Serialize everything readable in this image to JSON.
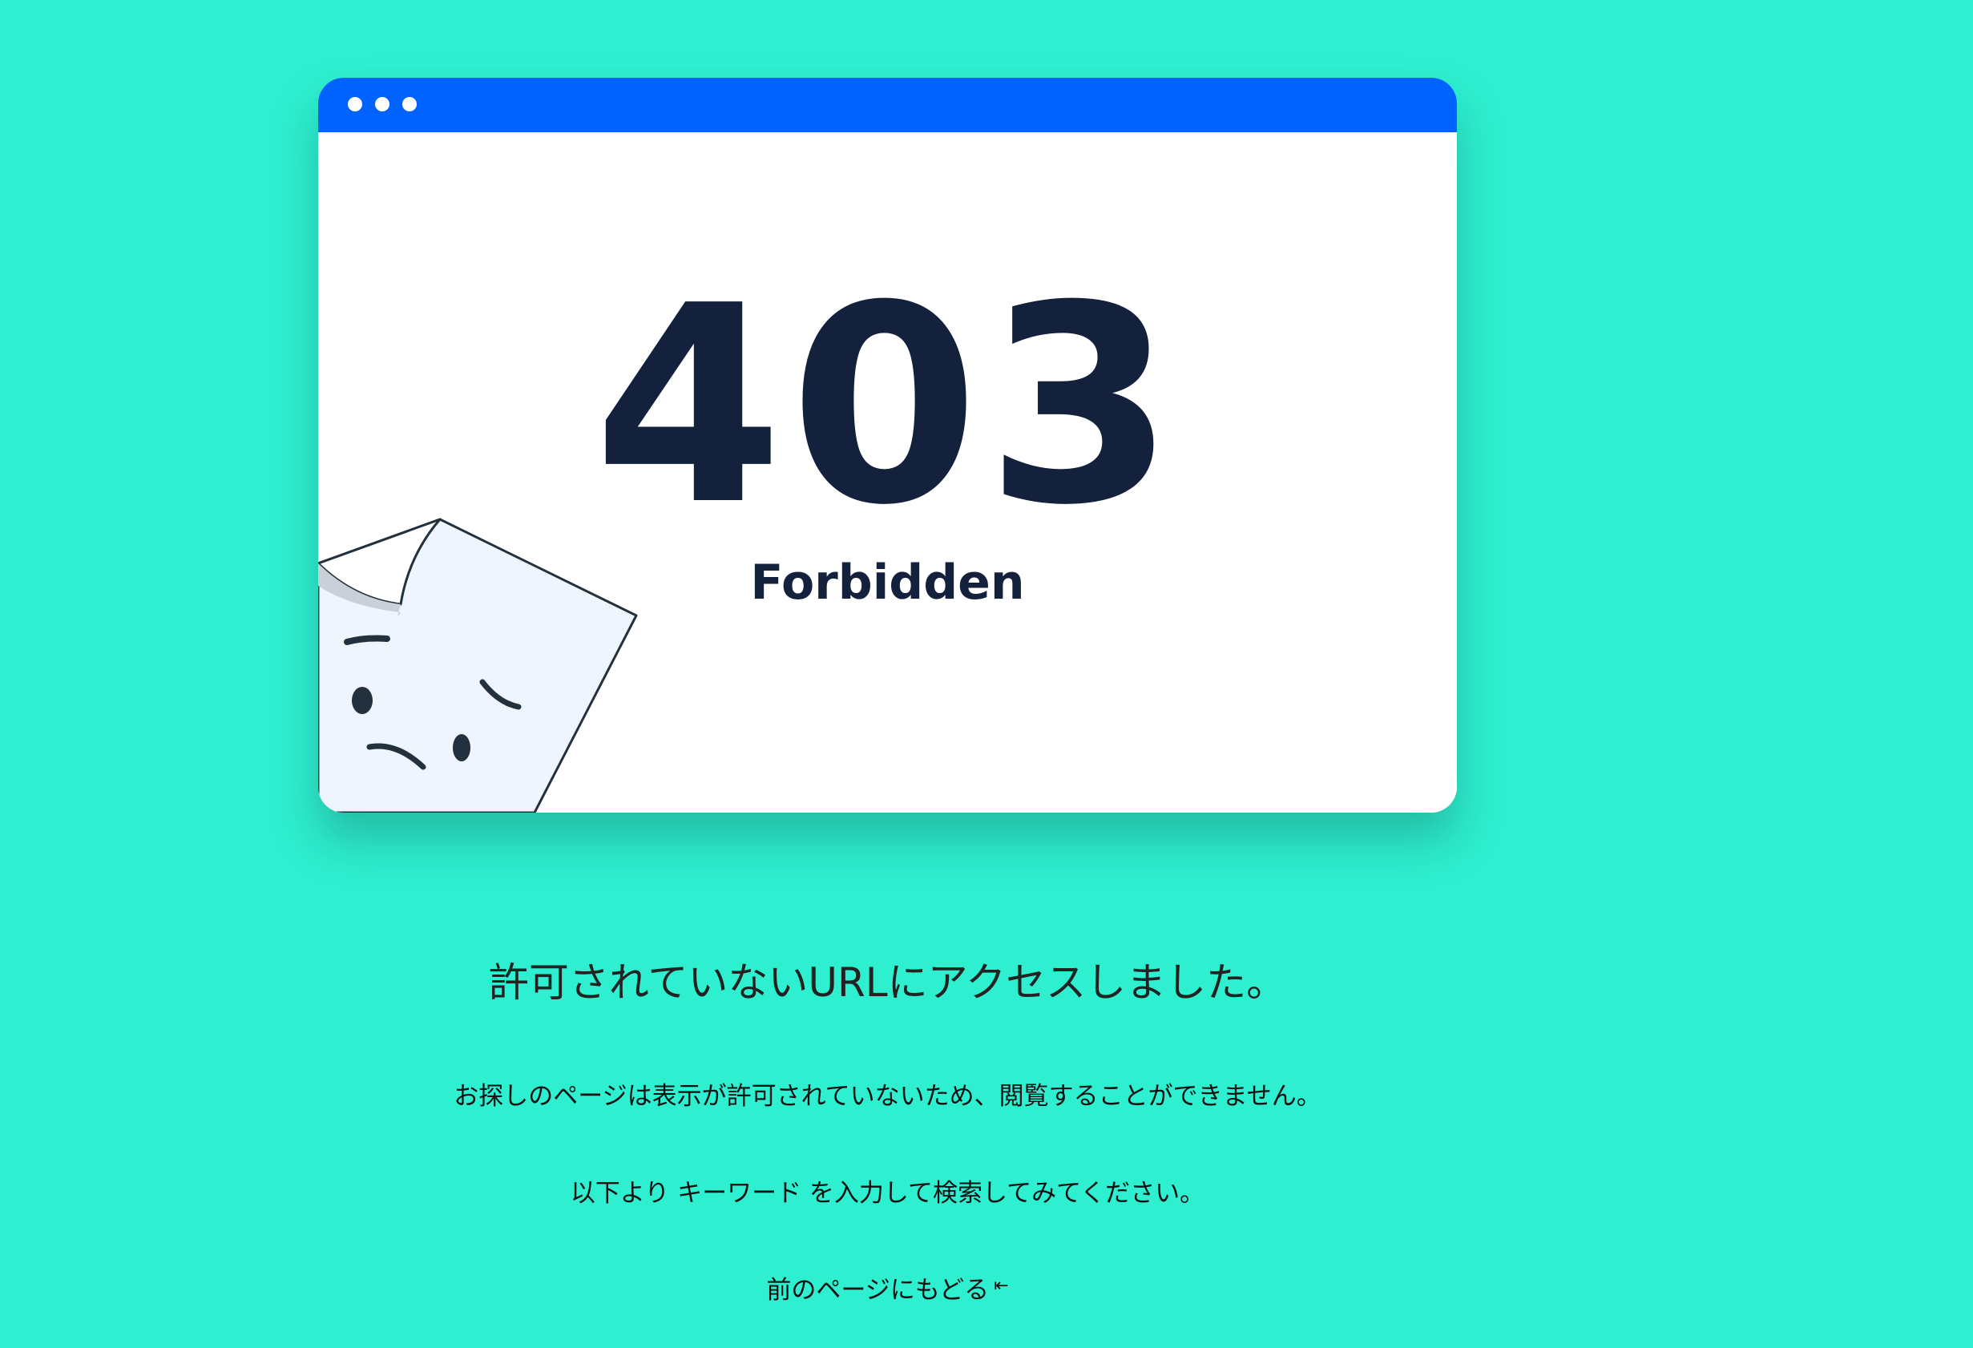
{
  "error": {
    "code": "403",
    "title": "Forbidden"
  },
  "messages": {
    "main": "許可されていないURLにアクセスしました。",
    "detail": "お探しのページは表示が許可されていないため、閲覧することができません。",
    "search_hint": "以下より キーワード を入力して検索してみてください。"
  },
  "navigation": {
    "back_label": "前のページにもどる",
    "back_icon_glyph": "⇤",
    "back_icon_name": "return-icon"
  },
  "colors": {
    "background": "#2eefd0",
    "titlebar": "#0062ff",
    "card": "#ffffff",
    "heading": "#14213d",
    "text": "#111111",
    "sad_page_fill": "#eef5ff"
  }
}
